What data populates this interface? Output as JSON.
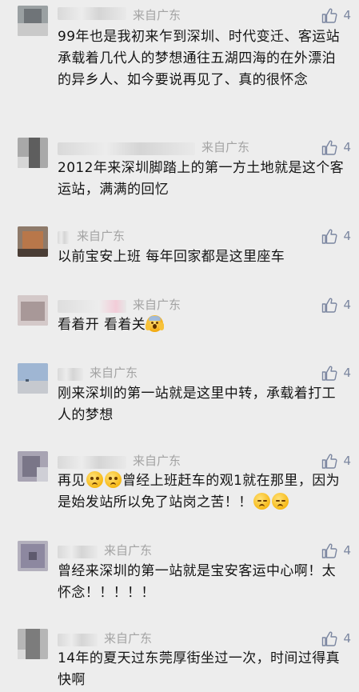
{
  "comments": [
    {
      "location": "来自广东",
      "likes": "4",
      "text": "99年也是我初来乍到深圳、时代变迁、客运站承载着几代人的梦想通往五湖四海的在外漂泊的异乡人、如今要说再见了、真的很怀念"
    },
    {
      "location": "来自广东",
      "likes": "4",
      "text": "2012年来深圳脚踏上的第一方土地就是这个客运站，满满的回忆"
    },
    {
      "location": "来自广东",
      "likes": "4",
      "text": "以前宝安上班  每年回家都是这里座车"
    },
    {
      "location": "来自广东",
      "likes": "4",
      "text": "看着开 看着关"
    },
    {
      "location": "来自广东",
      "likes": "4",
      "text": "刚来深圳的第一站就是这里中转，承载着打工人的梦想"
    },
    {
      "location": "来自广东",
      "likes": "4",
      "text_a": "再见",
      "text_b": "曾经上班赶车的观1就在那里，因为是始发站所以免了站岗之苦！！"
    },
    {
      "location": "来自广东",
      "likes": "4",
      "text": "曾经来深圳的第一站就是宝安客运中心啊！太怀念！！！！！"
    },
    {
      "location": "来自广东",
      "likes": "4",
      "text": "14年的夏天过东莞厚街坐过一次，时间过得真快啊"
    }
  ],
  "icons": {
    "like": "thumbs-up-icon",
    "shock_emoji": "scream-emoji",
    "blush_emoji": "flushed-emoji",
    "sad_emoji": "pensive-emoji"
  },
  "colors": {
    "background": "#ededed",
    "text": "#141414",
    "meta": "#a3a3a3",
    "like": "#7b86a0"
  }
}
